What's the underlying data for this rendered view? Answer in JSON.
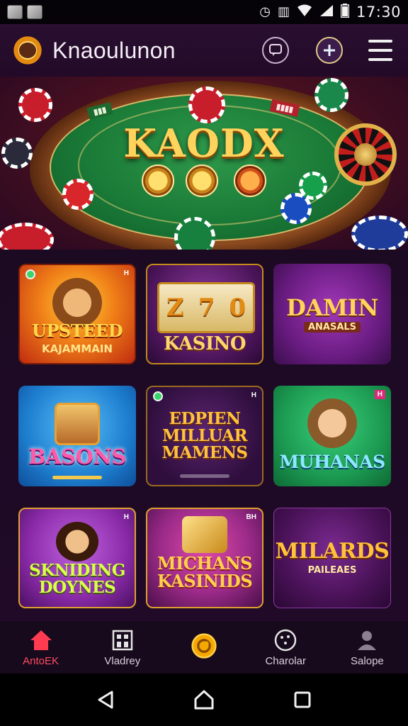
{
  "status_bar": {
    "time": "17:30",
    "icons": [
      "notification-icon",
      "alarm-icon",
      "vibrate-icon",
      "wifi-icon",
      "signal-icon",
      "battery-icon"
    ]
  },
  "header": {
    "title": "Knaoulunon",
    "icons": [
      "sun-logo-icon",
      "chat-icon",
      "add-icon",
      "menu-icon"
    ]
  },
  "hero": {
    "title": "KAODX",
    "accent_colors": {
      "felt": "#1a7a37",
      "gold": "#ffd35c",
      "wood": "#8b4a1f"
    }
  },
  "games": [
    {
      "title": "UPSTEED",
      "subtitle": "KAJAMMAIN",
      "badge": "H",
      "bg": "#e45a12"
    },
    {
      "title": "Z70",
      "subtitle": "KASINO",
      "badge": "",
      "bg": "#5a1e6a"
    },
    {
      "title": "DAMIN",
      "subtitle": "ANASALS",
      "badge": "",
      "bg": "#7a1c8e"
    },
    {
      "title": "BASONS",
      "subtitle": "",
      "badge": "",
      "bg": "#1e7fd0"
    },
    {
      "title": "EDPIEN MILLUAR MAMENS",
      "subtitle": "",
      "badge": "H",
      "bg": "#3a1550"
    },
    {
      "title": "MUHANAS",
      "subtitle": "",
      "badge": "H",
      "bg": "#1c9a52"
    },
    {
      "title": "SKNIDING DOYNES",
      "subtitle": "",
      "badge": "H",
      "bg": "#8a2aa8"
    },
    {
      "title": "MICHANS KASINIDS",
      "subtitle": "",
      "badge": "BH",
      "bg": "#9a2a88"
    },
    {
      "title": "MILARDS",
      "subtitle": "PAILEAES",
      "badge": "",
      "bg": "#4a1258"
    }
  ],
  "bottom_nav": [
    {
      "label": "AntoEK",
      "icon": "home-icon",
      "active": true
    },
    {
      "label": "Vladrey",
      "icon": "grid-icon",
      "active": false
    },
    {
      "label": "",
      "icon": "coin-icon",
      "active": false
    },
    {
      "label": "Charolar",
      "icon": "chip-icon",
      "active": false
    },
    {
      "label": "Salope",
      "icon": "profile-icon",
      "active": false
    }
  ],
  "system_nav": [
    "back-icon",
    "home-button-icon",
    "recents-icon"
  ]
}
